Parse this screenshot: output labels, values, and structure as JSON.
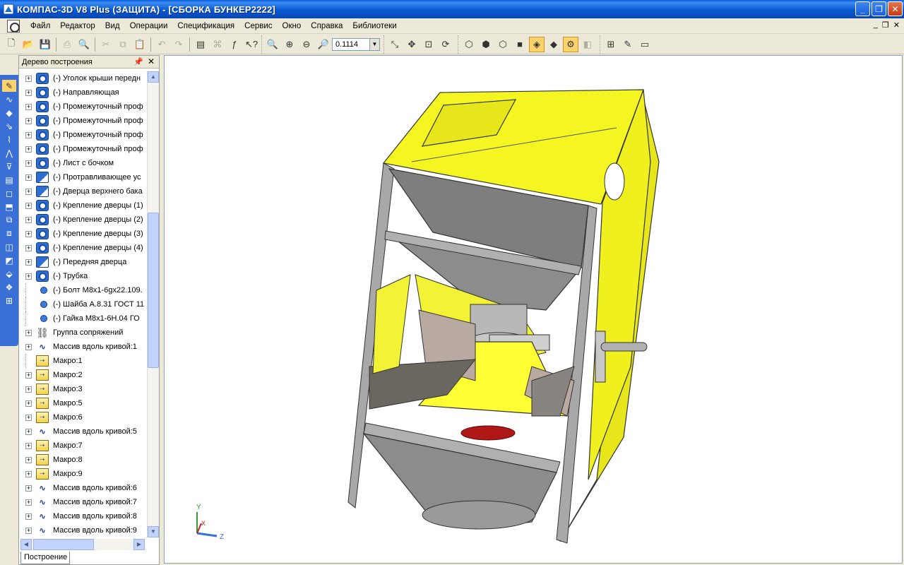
{
  "window": {
    "title": "КОМПАС-3D V8 Plus (ЗАЩИТА) - [СБОРКА БУНКЕР2222]",
    "buttons": [
      "_",
      "❐",
      "✕"
    ]
  },
  "menubar": {
    "items": [
      {
        "label": "Файл"
      },
      {
        "label": "Редактор"
      },
      {
        "label": "Вид"
      },
      {
        "label": "Операции"
      },
      {
        "label": "Спецификация"
      },
      {
        "label": "Сервис"
      },
      {
        "label": "Окно"
      },
      {
        "label": "Справка"
      },
      {
        "label": "Библиотеки"
      }
    ],
    "mdi_controls": [
      "_",
      "❐",
      "✕"
    ]
  },
  "toolbar": {
    "zoom_value": "0.1114"
  },
  "tree": {
    "title": "Дерево построения",
    "bottom_tab": "Построение",
    "items": [
      {
        "label": "(-) Уголок крыши передн",
        "icon": "part-icon",
        "expand": true
      },
      {
        "label": "(-) Направляющая",
        "icon": "part-icon",
        "expand": true
      },
      {
        "label": "(-) Промежуточный проф",
        "icon": "part-icon",
        "expand": true
      },
      {
        "label": "(-) Промежуточный проф",
        "icon": "part-icon",
        "expand": true
      },
      {
        "label": "(-) Промежуточный проф",
        "icon": "part-icon",
        "expand": true
      },
      {
        "label": "(-) Промежуточный проф",
        "icon": "part-icon",
        "expand": true
      },
      {
        "label": "(-) Лист с бочком",
        "icon": "part-icon",
        "expand": true
      },
      {
        "label": "(-) Протравливающее ус",
        "icon": "subassembly-icon",
        "expand": true
      },
      {
        "label": "(-) Дверца верхнего бака",
        "icon": "subassembly-icon",
        "expand": true
      },
      {
        "label": "(-) Крепление дверцы (1)",
        "icon": "part-icon",
        "expand": true
      },
      {
        "label": "(-) Крепление дверцы (2)",
        "icon": "part-icon",
        "expand": true
      },
      {
        "label": "(-) Крепление дверцы (3)",
        "icon": "part-icon",
        "expand": true
      },
      {
        "label": "(-) Крепление дверцы (4)",
        "icon": "part-icon",
        "expand": true
      },
      {
        "label": "(-) Передняя дверца",
        "icon": "subassembly-icon",
        "expand": true
      },
      {
        "label": "(-) Трубка",
        "icon": "part-icon",
        "expand": true
      },
      {
        "label": "(-) Болт М8х1-6gх22.109.",
        "icon": "standard-part-icon",
        "expand": false
      },
      {
        "label": "(-) Шайба А.8.31 ГОСТ 11",
        "icon": "standard-part-icon",
        "expand": false
      },
      {
        "label": "(-) Гайка  М8х1-6Н.04 ГО",
        "icon": "standard-part-icon",
        "expand": false
      },
      {
        "label": "Группа сопряжений",
        "icon": "mates-group-icon",
        "expand": true
      },
      {
        "label": "Массив вдоль кривой:1",
        "icon": "curve-array-icon",
        "expand": true
      },
      {
        "label": "Макро:1",
        "icon": "macro-icon",
        "expand": false
      },
      {
        "label": "Макро:2",
        "icon": "macro-icon",
        "expand": true
      },
      {
        "label": "Макро:3",
        "icon": "macro-icon",
        "expand": true
      },
      {
        "label": "Макро:5",
        "icon": "macro-icon",
        "expand": true
      },
      {
        "label": "Макро:6",
        "icon": "macro-icon",
        "expand": true
      },
      {
        "label": "Массив вдоль кривой:5",
        "icon": "curve-array-icon",
        "expand": true
      },
      {
        "label": "Макро:7",
        "icon": "macro-icon",
        "expand": true
      },
      {
        "label": "Макро:8",
        "icon": "macro-icon",
        "expand": true
      },
      {
        "label": "Макро:9",
        "icon": "macro-icon",
        "expand": true
      },
      {
        "label": "Массив вдоль кривой:6",
        "icon": "curve-array-icon",
        "expand": true
      },
      {
        "label": "Массив вдоль кривой:7",
        "icon": "curve-array-icon",
        "expand": true
      },
      {
        "label": "Массив вдоль кривой:8",
        "icon": "curve-array-icon",
        "expand": true
      },
      {
        "label": "Массив вдоль кривой:9",
        "icon": "curve-array-icon",
        "expand": true
      }
    ]
  },
  "viewport": {
    "axes": {
      "y": "Y",
      "x": "X",
      "z": "Z"
    },
    "colors": {
      "housing": "#f2f21a",
      "frame": "#9a9a9a",
      "hopper": "#8c8c8c",
      "cone": "#ffff33",
      "vanes": "#b8aaa0",
      "red_disc": "#b01818"
    }
  }
}
